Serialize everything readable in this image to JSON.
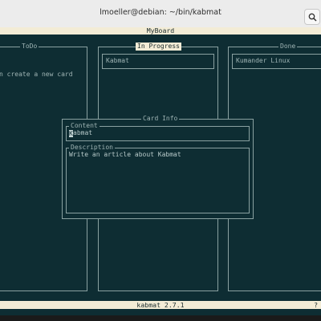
{
  "window": {
    "title": "lmoeller@debian: ~/bin/kabmat",
    "search_icon": "search-icon"
  },
  "app": {
    "board_name": "MyBoard",
    "version": "kabmat 2.7.1",
    "help_hint": "?",
    "colors": {
      "background": "#0e2d33",
      "bar": "#f3ecd6",
      "text": "#9fb4b4"
    }
  },
  "columns": [
    {
      "title": "ToDo",
      "hint": "n create a new card",
      "cards": []
    },
    {
      "title": "In Progress",
      "selected": true,
      "cards": [
        "Kabmat"
      ]
    },
    {
      "title": "Done",
      "cards": [
        "Kumander Linux"
      ]
    }
  ],
  "card_info": {
    "title": "Card Info",
    "content_label": "Content",
    "content_value": "abmat",
    "content_cursor_char": "K",
    "description_label": "Description",
    "description_value": "Write an article about Kabmat"
  }
}
